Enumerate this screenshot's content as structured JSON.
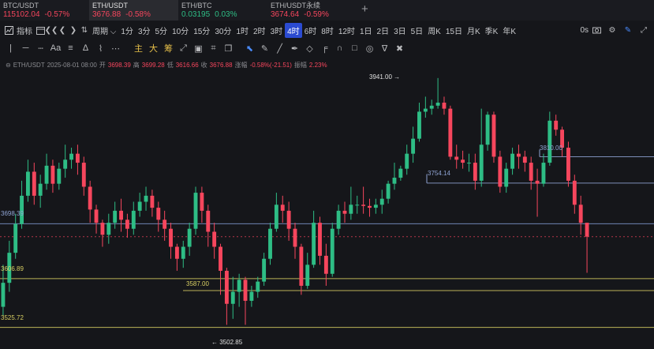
{
  "tabs": [
    {
      "name": "BTC/USDT",
      "price": "115102.04",
      "change": "-0.57%",
      "trend": "down",
      "active": false
    },
    {
      "name": "ETH/USDT",
      "price": "3676.88",
      "change": "-0.58%",
      "trend": "down",
      "active": true
    },
    {
      "name": "ETH/BTC",
      "price": "0.03195",
      "change": "0.03%",
      "trend": "up",
      "active": false
    },
    {
      "name": "ETH/USDT永续",
      "price": "3674.64",
      "change": "-0.59%",
      "trend": "down",
      "active": false
    }
  ],
  "toolbar": {
    "indicator_label": "指标",
    "period_label": "周期",
    "intervals": [
      "1分",
      "3分",
      "5分",
      "10分",
      "15分",
      "30分",
      "1时",
      "2时",
      "3时",
      "4时",
      "6时",
      "8时",
      "12时",
      "1日",
      "2日",
      "3日",
      "5日",
      "周K",
      "15日",
      "月K",
      "季K",
      "年K"
    ],
    "active_interval": "4时",
    "time_label": "0s"
  },
  "drawbar": {
    "text_tools": [
      "主",
      "大",
      "筹"
    ]
  },
  "info": {
    "symbol": "ETH/USDT",
    "datetime": "2025-08-01 08:00",
    "open_label": "开",
    "open": "3698.39",
    "high_label": "高",
    "high": "3699.28",
    "low_label": "低",
    "low": "3616.66",
    "close_label": "收",
    "close": "3676.88",
    "change_label": "涨幅",
    "change": "-0.58%(-21.51)",
    "amplitude_label": "振幅",
    "amplitude": "2.23%"
  },
  "chart_data": {
    "type": "candlestick",
    "y_range": [
      3495,
      3950
    ],
    "up_color": "#2ebd85",
    "down_color": "#f6465d",
    "annotations": {
      "max": "3941.00 →",
      "min": "← 3502.85",
      "left_labels": [
        "3698.39",
        "3606.89",
        "3525.72"
      ],
      "mid_labels": [
        "3587.00",
        "3754.14",
        "3810.00"
      ]
    },
    "horizontal_lines": [
      {
        "price": 3810,
        "color": "#8fa4d4",
        "from": 0.825
      },
      {
        "price": 3766,
        "color": "#8fa4d4",
        "from": 0.652
      },
      {
        "price": 3698.39,
        "color": "#7f97cf",
        "from": 0.0
      },
      {
        "price": 3606.89,
        "color": "#d8cf63",
        "from": 0.0
      },
      {
        "price": 3587,
        "color": "#d8cf63",
        "from": 0.28
      },
      {
        "price": 3525.72,
        "color": "#d8cf63",
        "from": 0.0
      }
    ],
    "current_price": 3676.88,
    "candles": [
      [
        3560,
        3600,
        3545,
        3630
      ],
      [
        3600,
        3650,
        3585,
        3670
      ],
      [
        3650,
        3698,
        3640,
        3715
      ],
      [
        3698,
        3745,
        3690,
        3770
      ],
      [
        3745,
        3785,
        3735,
        3805
      ],
      [
        3785,
        3745,
        3730,
        3800
      ],
      [
        3745,
        3765,
        3725,
        3780
      ],
      [
        3765,
        3795,
        3755,
        3815
      ],
      [
        3795,
        3765,
        3750,
        3805
      ],
      [
        3765,
        3790,
        3755,
        3800
      ],
      [
        3790,
        3805,
        3775,
        3830
      ],
      [
        3805,
        3815,
        3790,
        3825
      ],
      [
        3815,
        3800,
        3780,
        3830
      ],
      [
        3800,
        3760,
        3745,
        3810
      ],
      [
        3760,
        3722,
        3700,
        3770
      ],
      [
        3722,
        3700,
        3682,
        3730
      ],
      [
        3700,
        3680,
        3660,
        3705
      ],
      [
        3680,
        3700,
        3665,
        3715
      ],
      [
        3700,
        3720,
        3690,
        3735
      ],
      [
        3720,
        3705,
        3685,
        3740
      ],
      [
        3705,
        3690,
        3675,
        3715
      ],
      [
        3690,
        3720,
        3680,
        3735
      ],
      [
        3720,
        3735,
        3710,
        3750
      ],
      [
        3735,
        3745,
        3720,
        3760
      ],
      [
        3745,
        3725,
        3710,
        3755
      ],
      [
        3725,
        3705,
        3685,
        3735
      ],
      [
        3705,
        3690,
        3670,
        3720
      ],
      [
        3690,
        3660,
        3640,
        3700
      ],
      [
        3660,
        3640,
        3620,
        3665
      ],
      [
        3640,
        3660,
        3625,
        3670
      ],
      [
        3660,
        3690,
        3645,
        3700
      ],
      [
        3690,
        3750,
        3680,
        3760
      ],
      [
        3750,
        3720,
        3700,
        3760
      ],
      [
        3720,
        3685,
        3660,
        3730
      ],
      [
        3685,
        3660,
        3640,
        3700
      ],
      [
        3660,
        3620,
        3580,
        3665
      ],
      [
        3620,
        3565,
        3530,
        3625
      ],
      [
        3565,
        3585,
        3540,
        3610
      ],
      [
        3585,
        3605,
        3560,
        3615
      ],
      [
        3605,
        3570,
        3530,
        3610
      ],
      [
        3570,
        3585,
        3560,
        3595
      ],
      [
        3585,
        3602,
        3575,
        3610
      ],
      [
        3602,
        3640,
        3595,
        3650
      ],
      [
        3640,
        3690,
        3630,
        3700
      ],
      [
        3690,
        3730,
        3685,
        3750
      ],
      [
        3730,
        3720,
        3700,
        3745
      ],
      [
        3720,
        3690,
        3670,
        3735
      ],
      [
        3690,
        3660,
        3640,
        3700
      ],
      [
        3660,
        3595,
        3580,
        3665
      ],
      [
        3595,
        3630,
        3590,
        3650
      ],
      [
        3630,
        3700,
        3625,
        3720
      ],
      [
        3700,
        3645,
        3630,
        3710
      ],
      [
        3645,
        3615,
        3595,
        3665
      ],
      [
        3615,
        3690,
        3610,
        3700
      ],
      [
        3690,
        3720,
        3680,
        3730
      ],
      [
        3720,
        3715,
        3700,
        3735
      ],
      [
        3715,
        3730,
        3705,
        3760
      ],
      [
        3730,
        3730,
        3715,
        3745
      ],
      [
        3730,
        3728,
        3715,
        3760
      ],
      [
        3728,
        3725,
        3710,
        3740
      ],
      [
        3725,
        3730,
        3715,
        3740
      ],
      [
        3730,
        3740,
        3715,
        3755
      ],
      [
        3740,
        3765,
        3732,
        3770
      ],
      [
        3765,
        3775,
        3755,
        3800
      ],
      [
        3775,
        3790,
        3770,
        3795
      ],
      [
        3790,
        3815,
        3780,
        3830
      ],
      [
        3815,
        3840,
        3800,
        3860
      ],
      [
        3840,
        3885,
        3835,
        3900
      ],
      [
        3885,
        3890,
        3875,
        3910
      ],
      [
        3890,
        3895,
        3880,
        3905
      ],
      [
        3895,
        3900,
        3890,
        3941
      ],
      [
        3900,
        3890,
        3880,
        3910
      ],
      [
        3890,
        3810,
        3805,
        3895
      ],
      [
        3810,
        3805,
        3790,
        3830
      ],
      [
        3805,
        3800,
        3790,
        3820
      ],
      [
        3800,
        3800,
        3785,
        3815
      ],
      [
        3800,
        3770,
        3755,
        3815
      ],
      [
        3770,
        3830,
        3760,
        3890
      ],
      [
        3830,
        3880,
        3820,
        3885
      ],
      [
        3880,
        3810,
        3800,
        3885
      ],
      [
        3810,
        3760,
        3750,
        3820
      ],
      [
        3760,
        3790,
        3750,
        3800
      ],
      [
        3790,
        3815,
        3780,
        3825
      ],
      [
        3815,
        3810,
        3790,
        3830
      ],
      [
        3810,
        3800,
        3785,
        3820
      ],
      [
        3800,
        3770,
        3755,
        3810
      ],
      [
        3770,
        3765,
        3710,
        3790
      ],
      [
        3765,
        3800,
        3760,
        3815
      ],
      [
        3800,
        3870,
        3795,
        3885
      ],
      [
        3870,
        3855,
        3845,
        3880
      ],
      [
        3855,
        3825,
        3810,
        3860
      ],
      [
        3825,
        3770,
        3760,
        3835
      ],
      [
        3770,
        3730,
        3715,
        3780
      ],
      [
        3730,
        3700,
        3680,
        3745
      ],
      [
        3700,
        3676.88,
        3616.66,
        3699.28
      ]
    ]
  }
}
